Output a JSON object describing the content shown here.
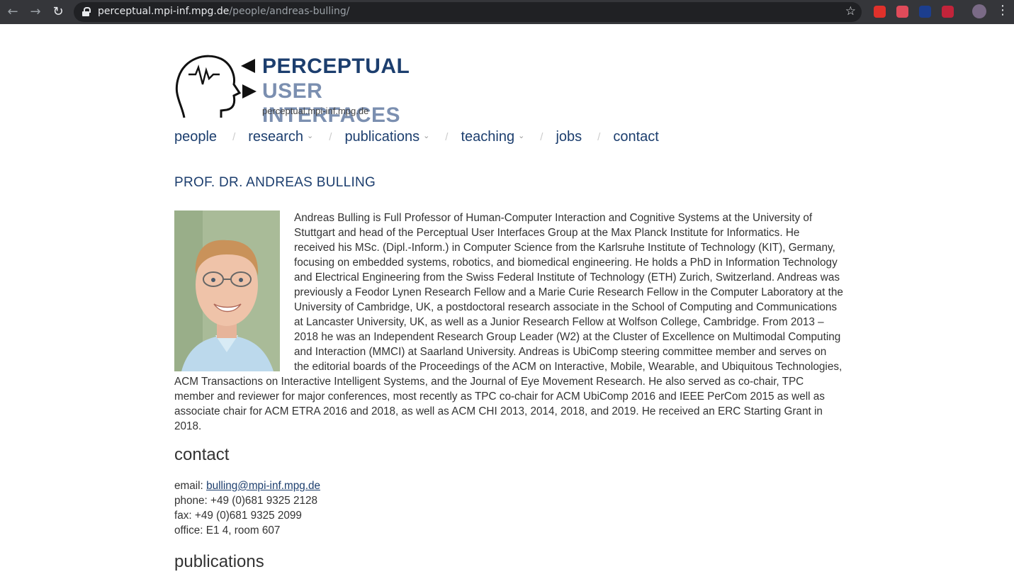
{
  "browser": {
    "url_host": "perceptual.mpi-inf.mpg.de",
    "url_path": "/people/andreas-bulling/",
    "extension_colors": [
      "#e0312b",
      "#e04b5a",
      "#1c3e8e",
      "#c2243a"
    ]
  },
  "logo": {
    "line1": "PERCEPTUAL",
    "line2": "USER INTERFACES",
    "site": "perceptual.mpi-inf.mpg.de"
  },
  "nav": {
    "items": [
      {
        "label": "people"
      },
      {
        "label": "research"
      },
      {
        "label": "publications"
      },
      {
        "label": "teaching"
      },
      {
        "label": "jobs"
      },
      {
        "label": "contact"
      }
    ],
    "separator": "/"
  },
  "profile": {
    "title": "PROF. DR. ANDREAS BULLING",
    "bio": "Andreas Bulling is Full Professor of Human-Computer Interaction and Cognitive Systems at the University of Stuttgart and head of the Perceptual User Interfaces Group at the Max Planck Institute for Informatics. He received his MSc. (Dipl.-Inform.) in Computer Science from the Karlsruhe Institute of Technology (KIT), Germany, focusing on embedded systems, robotics, and biomedical engineering. He holds a PhD in Information Technology and Electrical Engineering from the Swiss Federal Institute of Technology (ETH) Zurich, Switzerland. Andreas was previously a Feodor Lynen Research Fellow and a Marie Curie Research Fellow in the Computer Laboratory at the University of Cambridge, UK, a postdoctoral research associate in the School of Computing and Communications at Lancaster University, UK, as well as a Junior Research Fellow at Wolfson College, Cambridge. From 2013 – 2018 he was an Independent Research Group Leader (W2) at the Cluster of Excellence on Multimodal Computing and Interaction (MMCI) at Saarland University. Andreas is UbiComp steering committee member and serves on the editorial boards of the Proceedings of the ACM on Interactive, Mobile, Wearable, and Ubiquitous Technologies, ACM Transactions on Interactive Intelligent Systems, and the Journal of Eye Movement Research. He also served as co-chair, TPC member and reviewer for major conferences, most recently as TPC co-chair for ACM UbiComp 2016 and IEEE PerCom 2015 as well as associate chair for ACM ETRA 2016 and 2018, as well as ACM CHI 2013, 2014, 2018, and 2019. He received an ERC Starting Grant in 2018."
  },
  "contact": {
    "heading": "contact",
    "email_label": "email: ",
    "email": "bulling@mpi-inf.mpg.de",
    "phone": "phone: +49 (0)681 9325 2128",
    "fax": "fax: +49 (0)681 9325 2099",
    "office": "office: E1 4, room 607"
  },
  "publications": {
    "heading": "publications"
  }
}
